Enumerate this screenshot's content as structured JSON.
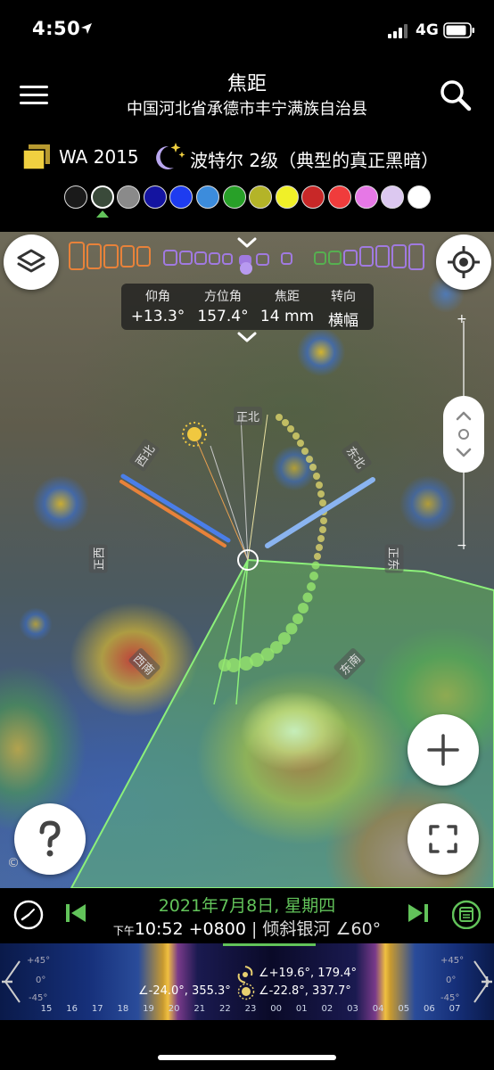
{
  "status_bar": {
    "time": "4:50",
    "network": "4G"
  },
  "header": {
    "title": "焦距",
    "subtitle": "中国河北省承德市丰宁满族自治县"
  },
  "filter": {
    "wa_label": "WA 2015",
    "bortle_label": "波特尔 2级（典型的真正黑暗）"
  },
  "color_swatches": [
    {
      "name": "black",
      "color": "#1a1a1a"
    },
    {
      "name": "dark-gray",
      "color": "#3a4a3a"
    },
    {
      "name": "gray",
      "color": "#8a8a8a"
    },
    {
      "name": "navy",
      "color": "#1414a0"
    },
    {
      "name": "blue",
      "color": "#1e3cf0"
    },
    {
      "name": "light-blue",
      "color": "#3c8cdc"
    },
    {
      "name": "green",
      "color": "#28a028"
    },
    {
      "name": "olive",
      "color": "#b4b428"
    },
    {
      "name": "yellow",
      "color": "#f0f028"
    },
    {
      "name": "dark-red",
      "color": "#c82828"
    },
    {
      "name": "red",
      "color": "#f03c3c"
    },
    {
      "name": "pink",
      "color": "#e678e6"
    },
    {
      "name": "lavender",
      "color": "#dcc8f0"
    },
    {
      "name": "white",
      "color": "#ffffff"
    }
  ],
  "selected_swatch": 1,
  "info_panel": {
    "elevation_label": "仰角",
    "elevation_value": "+13.3°",
    "azimuth_label": "方位角",
    "azimuth_value": "157.4°",
    "focal_label": "焦距",
    "focal_value": "14 mm",
    "orientation_label": "转向",
    "orientation_value": "横幅"
  },
  "compass": {
    "north": "正北",
    "northwest": "西北",
    "northeast": "东北",
    "west": "正西",
    "east": "正东",
    "southwest": "西南",
    "southeast": "东南"
  },
  "zoom_track": {
    "top_label": "+",
    "bottom_label": "−"
  },
  "copyright_text": "©",
  "timebar": {
    "date": "2021年7月8日, 星期四",
    "ampm": "下午",
    "time": "10:52 +0800",
    "mode": "| 倾斜银河 ∠60°"
  },
  "timeline": {
    "hours": [
      "15",
      "16",
      "17",
      "18",
      "19",
      "20",
      "21",
      "22",
      "23",
      "00",
      "01",
      "02",
      "03",
      "04",
      "05",
      "06",
      "07"
    ],
    "sun_elevation_line": "∠+19.6°,  179.4°",
    "moon_line": "∠-24.0°,  355.3°",
    "galaxy_line": "∠-22.8°,  337.7°",
    "left_marks": [
      "+45°",
      "0°",
      "-45°"
    ],
    "right_marks": [
      "+45°",
      "0°",
      "-45°"
    ]
  },
  "icons": {
    "menu": "menu-icon",
    "search": "search-icon",
    "layers": "layers-icon",
    "gps": "crosshair-icon",
    "zoom_in": "plus-icon",
    "help": "question-icon",
    "fullscreen": "fullscreen-icon",
    "clock": "clock-icon",
    "prev": "skip-back-icon",
    "next": "skip-forward-icon",
    "calendar": "calendar-icon"
  },
  "colors": {
    "accent_green": "#62c35a",
    "orange_line": "#e87a30",
    "blue_line": "#4a7ee8",
    "light_blue_line": "#8ab4f0"
  }
}
